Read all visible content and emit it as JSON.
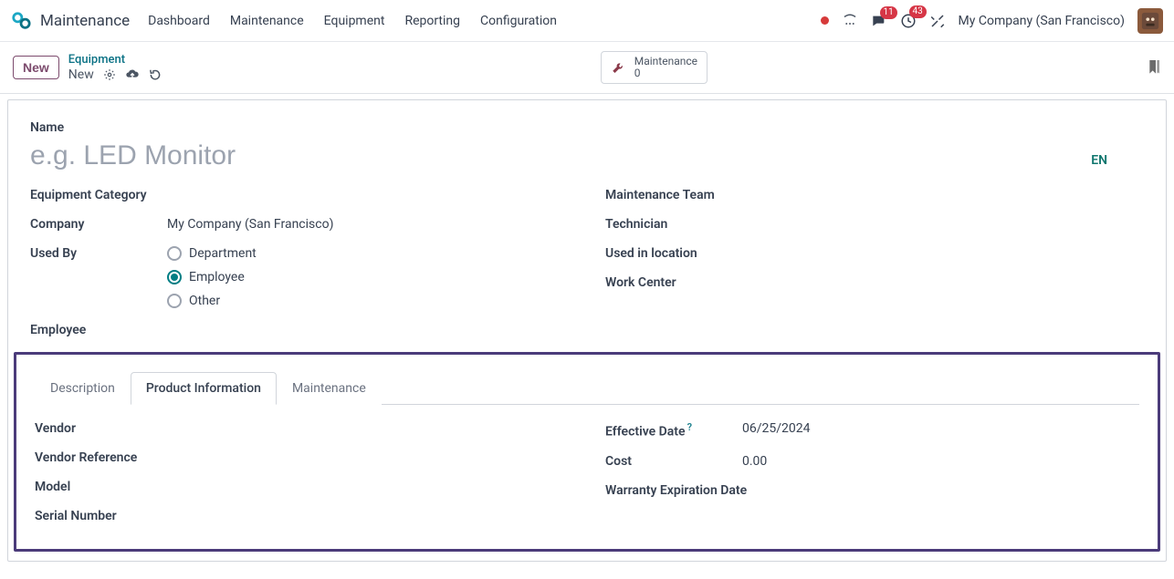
{
  "nav": {
    "app_title": "Maintenance",
    "links": [
      "Dashboard",
      "Maintenance",
      "Equipment",
      "Reporting",
      "Configuration"
    ],
    "messages_badge": "11",
    "activities_badge": "43",
    "company": "My Company (San Francisco)"
  },
  "controlbar": {
    "new_btn": "New",
    "breadcrumb_parent": "Equipment",
    "breadcrumb_current": "New",
    "maint_label": "Maintenance",
    "maint_count": "0"
  },
  "form": {
    "name_label": "Name",
    "name_placeholder": "e.g. LED Monitor",
    "lang": "EN",
    "left": {
      "category_label": "Equipment Category",
      "company_label": "Company",
      "company_value": "My Company (San Francisco)",
      "usedby_label": "Used By",
      "radio": {
        "department": "Department",
        "employee": "Employee",
        "other": "Other"
      },
      "employee_label": "Employee"
    },
    "right": {
      "team_label": "Maintenance Team",
      "technician_label": "Technician",
      "location_label": "Used in location",
      "workcenter_label": "Work Center"
    },
    "tabs": {
      "desc": "Description",
      "prod": "Product Information",
      "maint": "Maintenance"
    },
    "prod_left": {
      "vendor": "Vendor",
      "vendor_ref": "Vendor Reference",
      "model": "Model",
      "serial": "Serial Number"
    },
    "prod_right": {
      "eff_date_label": "Effective Date",
      "eff_date_value": "06/25/2024",
      "cost_label": "Cost",
      "cost_value": "0.00",
      "warranty_label": "Warranty Expiration Date"
    }
  }
}
